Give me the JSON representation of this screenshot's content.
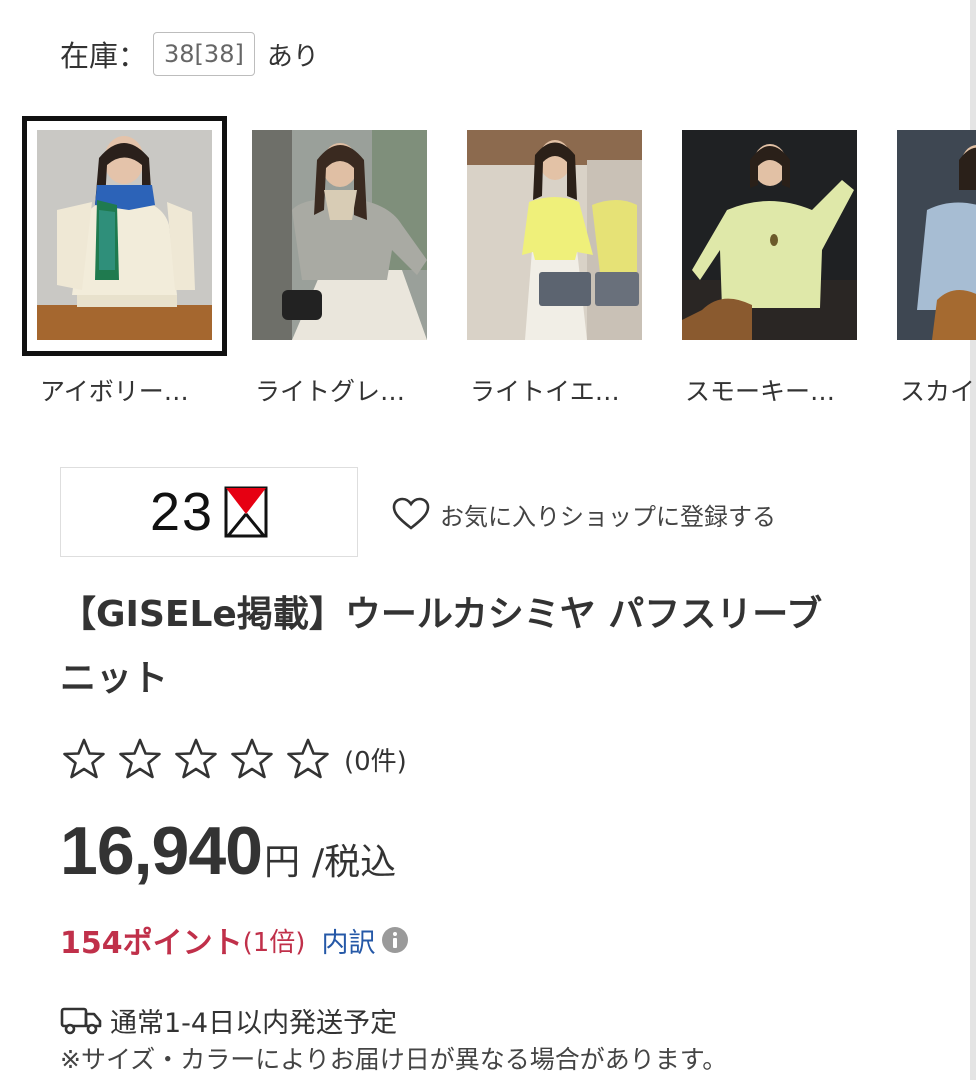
{
  "stock": {
    "label": "在庫：",
    "count": "38[38]",
    "suffix": "あり"
  },
  "swatches": [
    {
      "name": "アイボリー…",
      "selected": true
    },
    {
      "name": "ライトグレ…",
      "selected": false
    },
    {
      "name": "ライトイエ…",
      "selected": false
    },
    {
      "name": "スモーキー…",
      "selected": false
    },
    {
      "name": "スカイ",
      "selected": false
    }
  ],
  "brand": {
    "logo_text": "23"
  },
  "favorite": {
    "label": "お気に入りショップに登録する"
  },
  "product": {
    "title_line1": "【GISELe掲載】ウールカシミヤ パフスリーブ",
    "title_line2": "ニット"
  },
  "rating": {
    "stars": 0,
    "max": 5,
    "count": "(0件)"
  },
  "price": {
    "amount": "16,940",
    "yen": "円",
    "tax": "/税込"
  },
  "points": {
    "value": "154ポイント",
    "multiplier": "(1倍)",
    "breakdown": "内訳"
  },
  "shipping": {
    "text": "通常1-4日以内発送予定",
    "note": "※サイズ・カラーによりお届け日が異なる場合があります。"
  },
  "colors": {
    "points": "#c0304a",
    "link": "#2558a7",
    "logo_red": "#e60012"
  },
  "icons": [
    "heart-icon",
    "star-icon",
    "info-icon",
    "truck-icon"
  ]
}
